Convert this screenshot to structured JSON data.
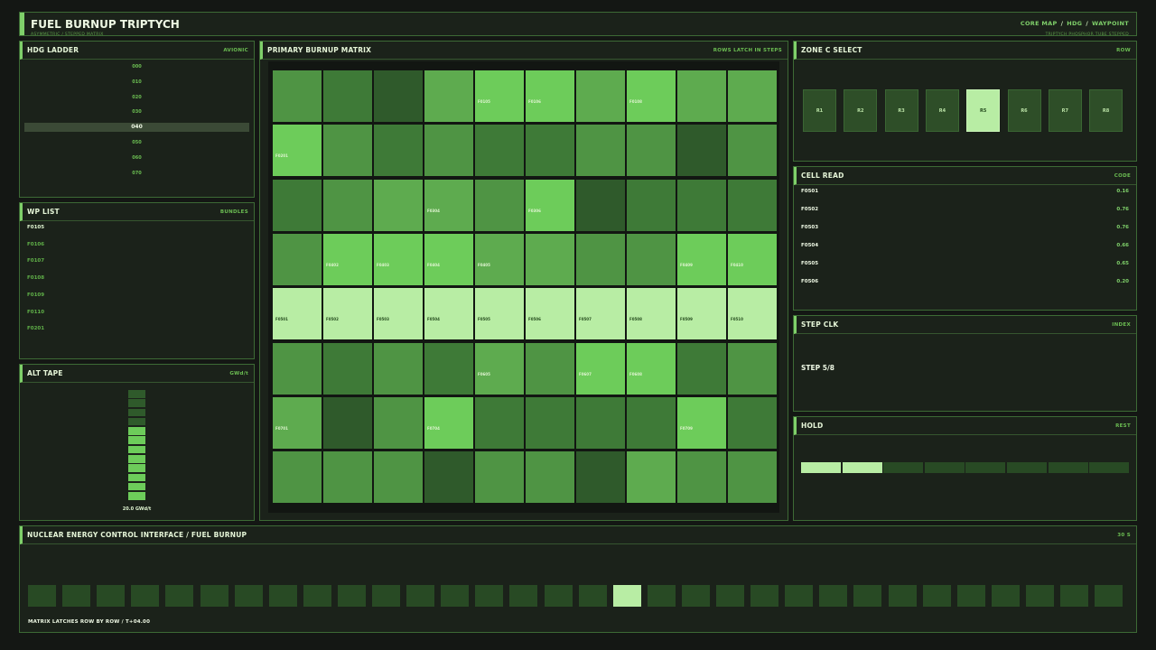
{
  "header": {
    "title": "FUEL BURNUP TRIPTYCH",
    "subtitle": "ASYMMETRIC / STEPPED MATRIX",
    "nav": [
      "CORE MAP",
      "HDG",
      "WAYPOINT"
    ],
    "right_sub": "TRIPTYCH PHOSPHOR TUBE STEPPED"
  },
  "hdg": {
    "title": "HDG LADDER",
    "tag": "AVIONIC",
    "ticks": [
      "000",
      "010",
      "020",
      "030",
      "040",
      "050",
      "060",
      "070"
    ],
    "active_index": 4
  },
  "wp": {
    "title": "WP LIST",
    "tag": "BUNDLES",
    "items": [
      "F0105",
      "F0106",
      "F0107",
      "F0108",
      "F0109",
      "F0110",
      "F0201"
    ]
  },
  "alt": {
    "title": "ALT TAPE",
    "tag": "GWd/t",
    "value_label": "20.0 GWd/t",
    "segments_total": 12,
    "segments_lit": 8
  },
  "matrix": {
    "title": "PRIMARY  BURNUP MATRIX",
    "tag": "ROWS LATCH IN STEPS",
    "rows": [
      [
        2,
        1,
        0,
        3,
        4,
        4,
        3,
        4,
        3,
        3
      ],
      [
        4,
        2,
        1,
        2,
        1,
        1,
        2,
        2,
        0,
        2
      ],
      [
        1,
        2,
        3,
        3,
        2,
        4,
        0,
        1,
        1,
        1
      ],
      [
        2,
        4,
        4,
        4,
        3,
        3,
        2,
        2,
        4,
        4
      ],
      [
        5,
        5,
        5,
        5,
        5,
        5,
        5,
        5,
        5,
        5
      ],
      [
        2,
        1,
        2,
        1,
        3,
        2,
        4,
        4,
        1,
        2
      ],
      [
        3,
        0,
        2,
        4,
        1,
        1,
        1,
        1,
        4,
        1
      ],
      [
        2,
        2,
        2,
        0,
        2,
        2,
        0,
        3,
        2,
        2
      ]
    ],
    "labels": [
      {
        "r": 0,
        "c": 4,
        "text": "F0105"
      },
      {
        "r": 0,
        "c": 5,
        "text": "F0106"
      },
      {
        "r": 0,
        "c": 7,
        "text": "F0108"
      },
      {
        "r": 1,
        "c": 0,
        "text": "F0201"
      },
      {
        "r": 2,
        "c": 3,
        "text": "F0304"
      },
      {
        "r": 2,
        "c": 5,
        "text": "F0306"
      },
      {
        "r": 3,
        "c": 1,
        "text": "F0402"
      },
      {
        "r": 3,
        "c": 2,
        "text": "F0403"
      },
      {
        "r": 3,
        "c": 3,
        "text": "F0404"
      },
      {
        "r": 3,
        "c": 4,
        "text": "F0405"
      },
      {
        "r": 3,
        "c": 8,
        "text": "F0409"
      },
      {
        "r": 3,
        "c": 9,
        "text": "F0410"
      },
      {
        "r": 4,
        "c": 0,
        "text": "F0501"
      },
      {
        "r": 4,
        "c": 1,
        "text": "F0502"
      },
      {
        "r": 4,
        "c": 2,
        "text": "F0503"
      },
      {
        "r": 4,
        "c": 3,
        "text": "F0504"
      },
      {
        "r": 4,
        "c": 4,
        "text": "F0505"
      },
      {
        "r": 4,
        "c": 5,
        "text": "F0506"
      },
      {
        "r": 4,
        "c": 6,
        "text": "F0507"
      },
      {
        "r": 4,
        "c": 7,
        "text": "F0508"
      },
      {
        "r": 4,
        "c": 8,
        "text": "F0509"
      },
      {
        "r": 4,
        "c": 9,
        "text": "F0510"
      },
      {
        "r": 5,
        "c": 4,
        "text": "F0605"
      },
      {
        "r": 5,
        "c": 6,
        "text": "F0607"
      },
      {
        "r": 5,
        "c": 7,
        "text": "F0608"
      },
      {
        "r": 6,
        "c": 0,
        "text": "F0701"
      },
      {
        "r": 6,
        "c": 3,
        "text": "F0704"
      },
      {
        "r": 6,
        "c": 8,
        "text": "F0709"
      }
    ],
    "palette": [
      "#2f5a2b",
      "#3e7a37",
      "#4f9444",
      "#5eab4f",
      "#6dcc5a",
      "#b8eda4"
    ]
  },
  "zone": {
    "title": "ZONE C  SELECT",
    "tag": "ROW",
    "buttons": [
      "R1",
      "R2",
      "R3",
      "R4",
      "R5",
      "R6",
      "R7",
      "R8"
    ],
    "selected_index": 4
  },
  "cell_read": {
    "title": "CELL READ",
    "tag": "CODE",
    "rows": [
      {
        "k": "F0501",
        "v": "0.16"
      },
      {
        "k": "F0502",
        "v": "0.76"
      },
      {
        "k": "F0503",
        "v": "0.76"
      },
      {
        "k": "F0504",
        "v": "0.66"
      },
      {
        "k": "F0505",
        "v": "0.65"
      },
      {
        "k": "F0506",
        "v": "0.20"
      }
    ]
  },
  "step": {
    "title": "STEP CLK",
    "tag": "INDEX",
    "value": "STEP 5/8"
  },
  "hold": {
    "title": "HOLD",
    "tag": "REST",
    "segments_total": 8,
    "segments_lit": 2
  },
  "strip": {
    "title": "NUCLEAR ENERGY CONTROL INTERFACE  /  FUEL BURNUP",
    "tag": "30 S",
    "segments_total": 32,
    "active_index": 17,
    "footer": "MATRIX LATCHES ROW BY ROW  /  T+04.00"
  }
}
